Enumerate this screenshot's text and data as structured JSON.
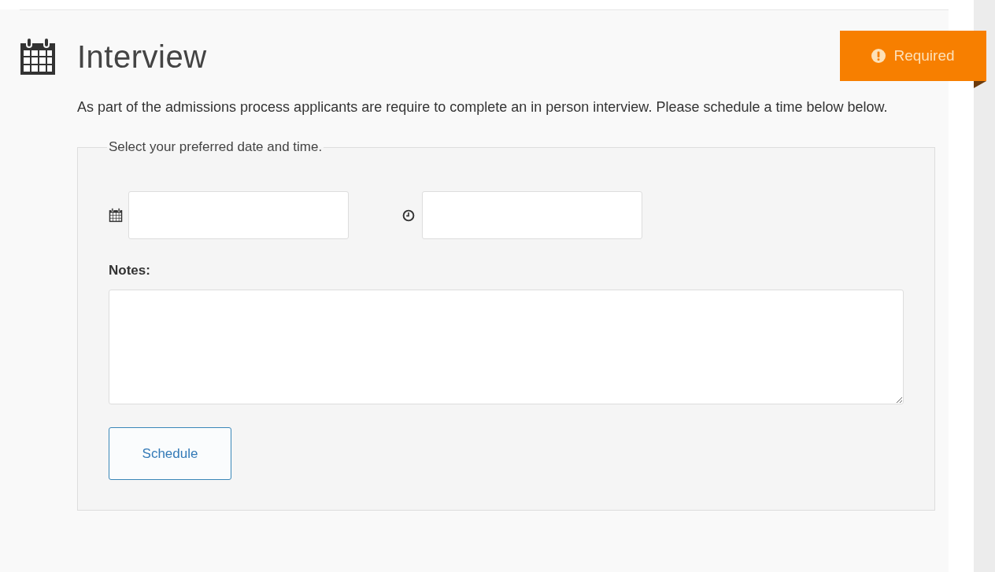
{
  "section": {
    "title": "Interview",
    "badge": {
      "label": "Required"
    },
    "description": "As part of the admissions process applicants are require to complete an in person interview. Please schedule a time below below."
  },
  "form": {
    "legend": "Select your preferred date and time.",
    "fields": [
      {
        "kind": "date"
      },
      {
        "kind": "time"
      }
    ],
    "notes_label": "Notes:",
    "button": "Schedule"
  }
}
